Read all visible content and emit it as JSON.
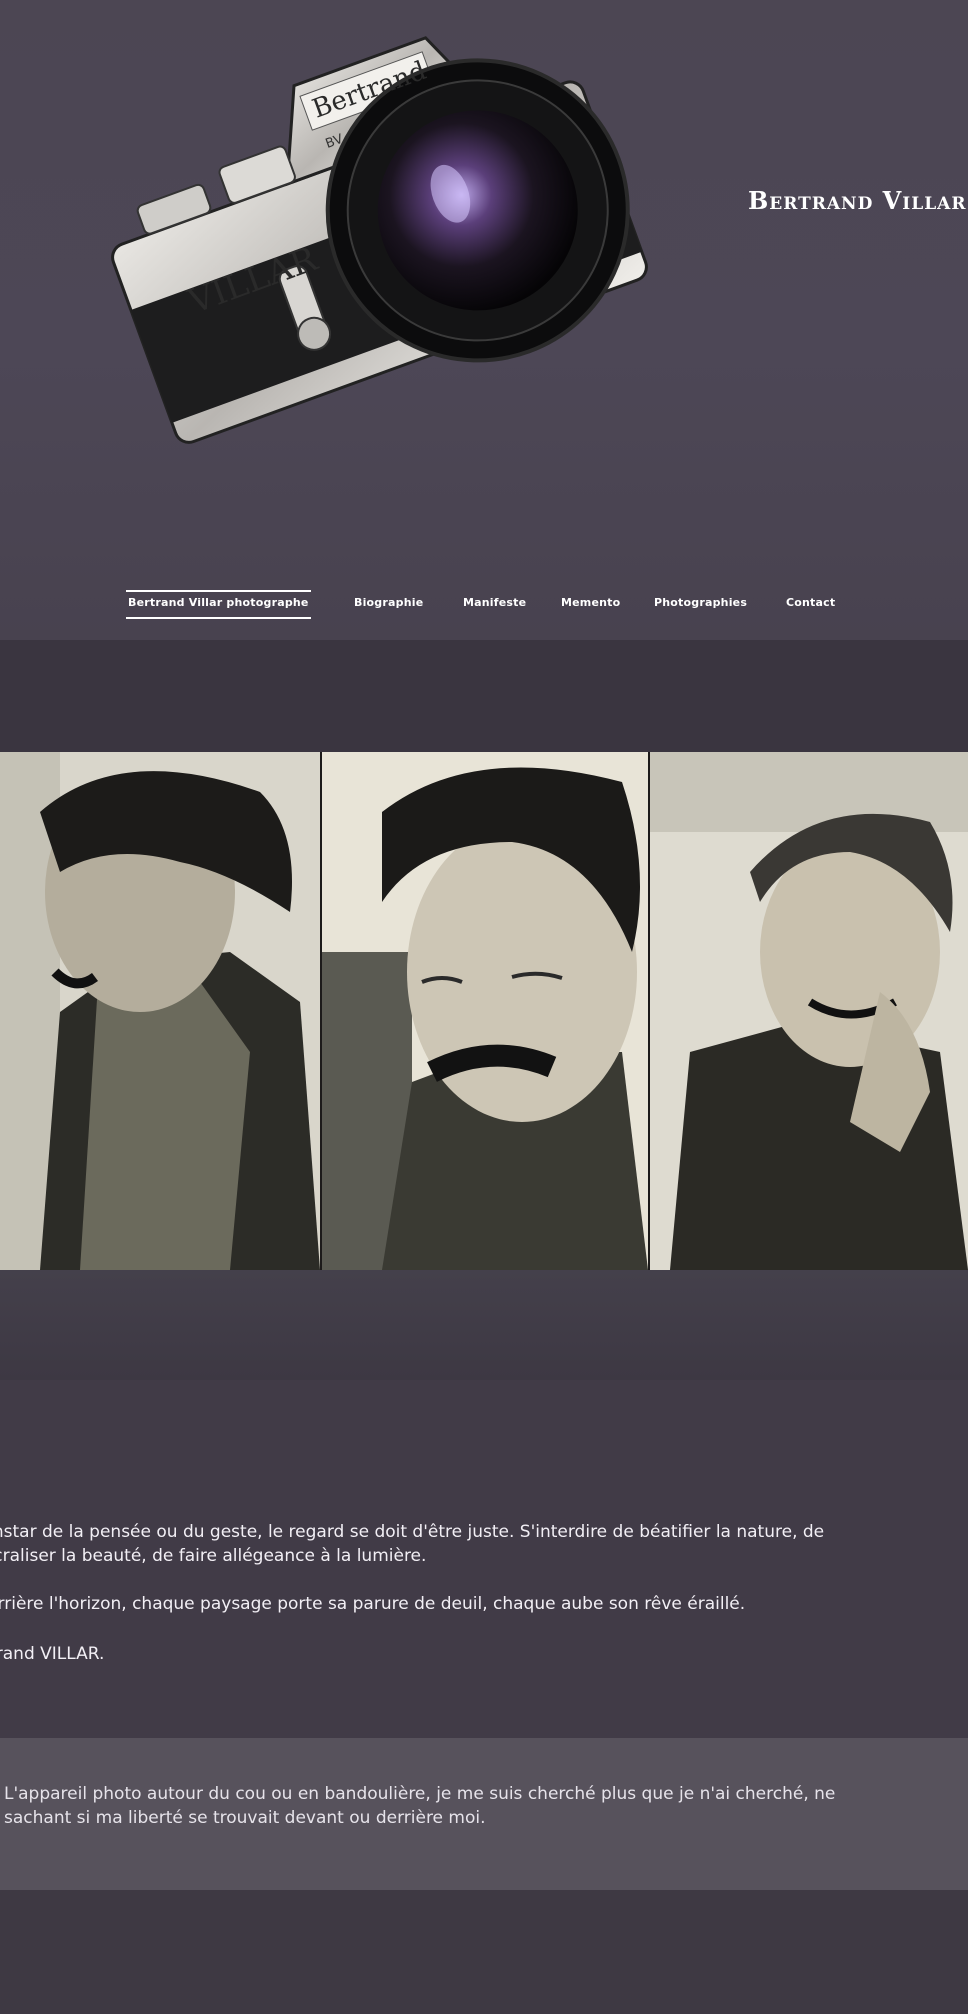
{
  "header": {
    "site_title": "Bertrand Villar",
    "camera": {
      "brand_body": "VILLAR",
      "brand_prism": "Bertrand",
      "badge": "BV"
    }
  },
  "nav": {
    "items": [
      {
        "label": "Bertrand Villar photographe",
        "active": true
      },
      {
        "label": "Biographie",
        "active": false
      },
      {
        "label": "Manifeste",
        "active": false
      },
      {
        "label": "Memento",
        "active": false
      },
      {
        "label": "Photographies",
        "active": false
      },
      {
        "label": "Contact",
        "active": false
      }
    ]
  },
  "portraits": [
    {
      "alt": "Portrait profile"
    },
    {
      "alt": "Portrait eyes closed"
    },
    {
      "alt": "Portrait laughing"
    }
  ],
  "manifesto": {
    "paragraph_1": "L'instar de la pensée ou du geste, le regard se doit d'être juste. S'interdire de béatifier la nature, de\nsacraliser la beauté, de faire allégeance à la lumière.",
    "paragraph_2": "Derrière l'horizon, chaque paysage porte sa parure de deuil, chaque aube son rêve éraillé.",
    "signature": "Bertrand VILLAR."
  },
  "quote_box": {
    "text": "L'appareil photo autour du cou ou en bandoulière, je me suis cherché plus que je n'ai cherché, ne\nsachant si ma liberté se trouvait devant ou derrière moi."
  },
  "colors": {
    "background": "#3f3a44",
    "header": "#4c4653",
    "text": "#f2eff5",
    "quote_box": "#57525c"
  }
}
